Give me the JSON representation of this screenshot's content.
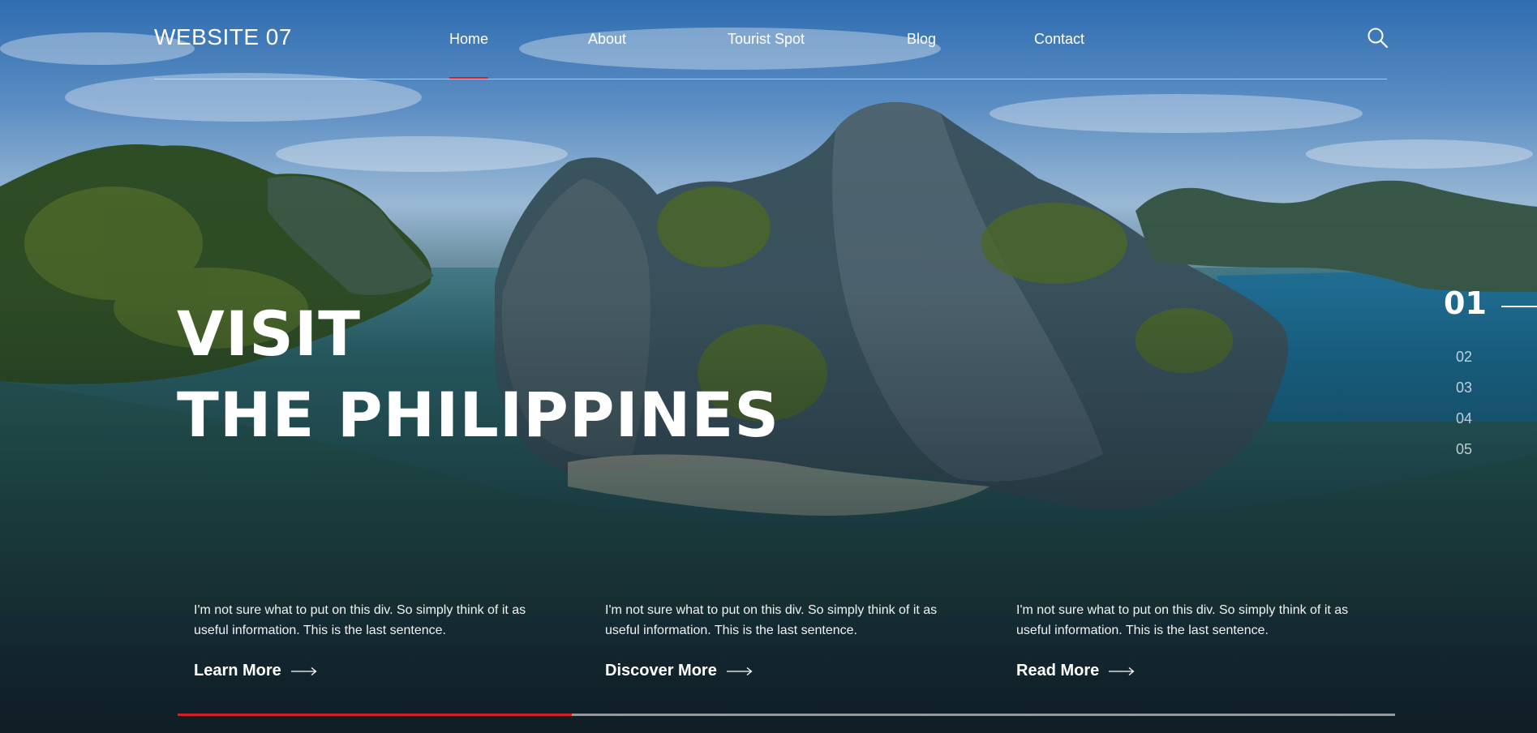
{
  "header": {
    "logo": "WEBSITE 07",
    "nav": [
      "Home",
      "About",
      "Tourist Spot",
      "Blog",
      "Contact"
    ],
    "active_nav": "Home",
    "search_icon": "search-icon"
  },
  "hero": {
    "headline_line1": "VISIT",
    "headline_line2": "THE PHILIPPINES"
  },
  "slides": {
    "current": "01",
    "others": [
      "02",
      "03",
      "04",
      "05"
    ]
  },
  "cards": [
    {
      "text": "I'm not sure what to put on this div. So simply think of it as useful information. This is the last sentence.",
      "link": "Learn More",
      "icon": "arrow-right-icon"
    },
    {
      "text": "I'm not sure what to put on this div. So simply think of it as useful information. This is the last sentence.",
      "link": "Discover More",
      "icon": "arrow-right-icon"
    },
    {
      "text": "I'm not sure what to put on this div. So simply think of it as useful information. This is the last sentence.",
      "link": "Read More",
      "icon": "arrow-right-icon"
    }
  ],
  "progress": {
    "fraction": 0.324
  },
  "colors": {
    "accent": "#d41f26",
    "text": "#ffffff"
  }
}
